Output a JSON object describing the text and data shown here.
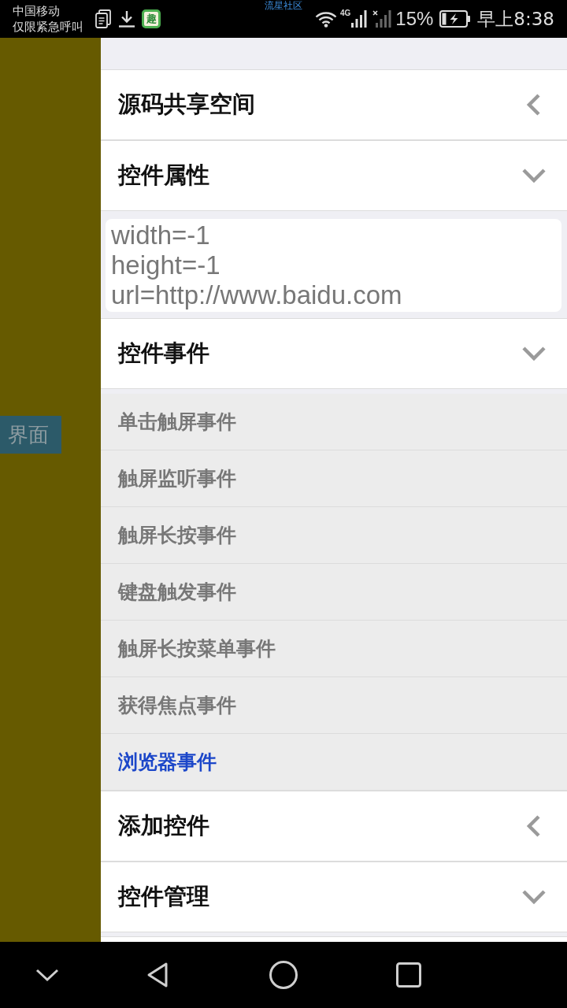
{
  "status_bar": {
    "carrier": "中国移动",
    "carrier_status": "仅限紧急呼叫",
    "notification_icons": [
      {
        "kind": "document"
      },
      {
        "kind": "download"
      },
      {
        "kind": "app",
        "label": "趣"
      }
    ],
    "overlay_label": "流星社区",
    "network": "4G",
    "battery": "15%",
    "time": "早上8:38"
  },
  "side_panel": {
    "tab": "界面"
  },
  "sections": [
    {
      "title": "源码共享空间",
      "expanded": false
    },
    {
      "title": "控件属性",
      "expanded": true,
      "body": {
        "kind": "text",
        "value": "width=-1\nheight=-1\nurl=http://www.baidu.com"
      }
    },
    {
      "title": "控件事件",
      "expanded": true,
      "body": {
        "kind": "list",
        "items": [
          {
            "label": "单击触屏事件",
            "selected": false
          },
          {
            "label": "触屏监听事件",
            "selected": false
          },
          {
            "label": "触屏长按事件",
            "selected": false
          },
          {
            "label": "键盘触发事件",
            "selected": false
          },
          {
            "label": "触屏长按菜单事件",
            "selected": false
          },
          {
            "label": "获得焦点事件",
            "selected": false
          },
          {
            "label": "浏览器事件",
            "selected": true
          }
        ]
      }
    },
    {
      "title": "添加控件",
      "expanded": false
    },
    {
      "title": "控件管理",
      "expanded": true
    }
  ]
}
